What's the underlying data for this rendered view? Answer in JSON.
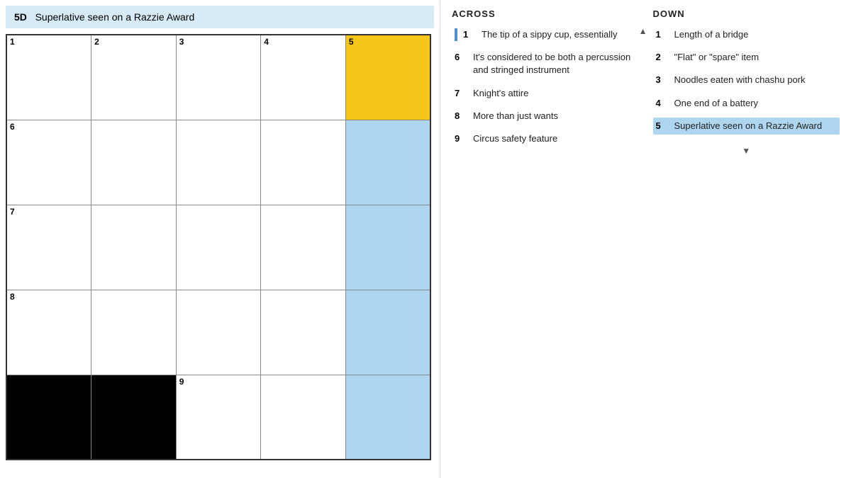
{
  "header": {
    "clue_label": "5D",
    "clue_text": "Superlative seen on a Razzie Award"
  },
  "grid": {
    "rows": [
      [
        {
          "type": "white",
          "number": "1"
        },
        {
          "type": "white",
          "number": "2"
        },
        {
          "type": "white",
          "number": "3"
        },
        {
          "type": "white",
          "number": "4"
        },
        {
          "type": "yellow",
          "number": "5"
        }
      ],
      [
        {
          "type": "white",
          "number": "6"
        },
        {
          "type": "white",
          "number": ""
        },
        {
          "type": "white",
          "number": ""
        },
        {
          "type": "white",
          "number": ""
        },
        {
          "type": "blue",
          "number": ""
        }
      ],
      [
        {
          "type": "white",
          "number": "7"
        },
        {
          "type": "white",
          "number": ""
        },
        {
          "type": "white",
          "number": ""
        },
        {
          "type": "white",
          "number": ""
        },
        {
          "type": "blue",
          "number": ""
        }
      ],
      [
        {
          "type": "white",
          "number": "8"
        },
        {
          "type": "white",
          "number": ""
        },
        {
          "type": "white",
          "number": ""
        },
        {
          "type": "white",
          "number": ""
        },
        {
          "type": "blue",
          "number": ""
        }
      ],
      [
        {
          "type": "black",
          "number": ""
        },
        {
          "type": "black",
          "number": ""
        },
        {
          "type": "white",
          "number": "9"
        },
        {
          "type": "white",
          "number": ""
        },
        {
          "type": "blue",
          "number": ""
        }
      ]
    ]
  },
  "across_clues": [
    {
      "number": "1",
      "text": "The tip of a sippy cup, essentially"
    },
    {
      "number": "6",
      "text": "It's considered to be both a percussion and stringed instrument"
    },
    {
      "number": "7",
      "text": "Knight's attire"
    },
    {
      "number": "8",
      "text": "More than just wants"
    },
    {
      "number": "9",
      "text": "Circus safety feature"
    }
  ],
  "down_clues": [
    {
      "number": "1",
      "text": "Length of a bridge"
    },
    {
      "number": "2",
      "text": "\"Flat\" or \"spare\" item"
    },
    {
      "number": "3",
      "text": "Noodles eaten with chashu pork"
    },
    {
      "number": "4",
      "text": "One end of a battery"
    },
    {
      "number": "5",
      "text": "Superlative seen on a Razzie Award",
      "active": true
    }
  ],
  "sections": {
    "across_title": "ACROSS",
    "down_title": "DOWN"
  }
}
